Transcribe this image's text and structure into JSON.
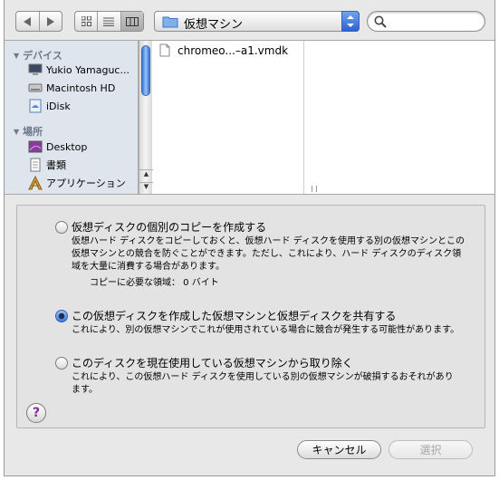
{
  "toolbar": {
    "back_icon": "back-arrow-icon",
    "forward_icon": "forward-arrow-icon",
    "view_modes": [
      "icon-view",
      "list-view",
      "column-view"
    ],
    "active_view": "column-view",
    "location": "仮想マシン",
    "search_value": ""
  },
  "sidebar": {
    "sections": [
      {
        "title": "デバイス",
        "items": [
          {
            "label": "Yukio Yamaguc...",
            "icon": "computer-icon"
          },
          {
            "label": "Macintosh HD",
            "icon": "hard-disk-icon"
          },
          {
            "label": "iDisk",
            "icon": "idisk-icon"
          }
        ]
      },
      {
        "title": "場所",
        "items": [
          {
            "label": "Desktop",
            "icon": "desktop-icon"
          },
          {
            "label": "書類",
            "icon": "documents-icon"
          },
          {
            "label": "アプリケーション",
            "icon": "applications-icon"
          }
        ]
      }
    ]
  },
  "browser": {
    "files": [
      {
        "name": "chromeo...–a1.vmdk",
        "icon": "document-icon"
      }
    ]
  },
  "options": {
    "copy": {
      "title": "仮想ディスクの個別のコピーを作成する",
      "description": "仮想ハード ディスクをコピーしておくと、仮想ハード ディスクを使用する別の仮想マシンとこの仮想マシンとの競合を防ぐことができます。ただし、これにより、ハード ディスクのディスク領域を大量に消費する場合があります。",
      "space_label": "コピーに必要な領域： 0 バイト",
      "selected": false
    },
    "share": {
      "title": "この仮想ディスクを作成した仮想マシンと仮想ディスクを共有する",
      "description": "これにより、別の仮想マシンでこれが使用されている場合に競合が発生する可能性があります。",
      "selected": true
    },
    "remove": {
      "title": "このディスクを現在使用している仮想マシンから取り除く",
      "description": "これにより、この仮想ハード ディスクを使用している別の仮想マシンが破損するおそれがあります。",
      "selected": false
    }
  },
  "help_label": "?",
  "buttons": {
    "cancel": "キャンセル",
    "select": "選択"
  }
}
